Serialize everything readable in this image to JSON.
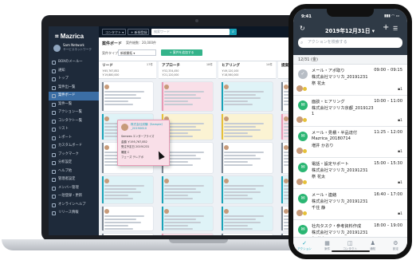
{
  "app": {
    "logo": "Mazrica",
    "user_name": "Sam Network",
    "user_company": "サービスネットワーク"
  },
  "sidebar": {
    "items": [
      {
        "label": "BOXのメール一",
        "active": false
      },
      {
        "label": "通知",
        "active": false
      },
      {
        "label": "トップ",
        "active": false
      },
      {
        "label": "案件出一覧",
        "active": false
      },
      {
        "label": "案件ボード",
        "active": true
      },
      {
        "label": "案件一覧",
        "active": false
      },
      {
        "label": "アクション一覧",
        "active": false
      },
      {
        "label": "コンタクト一覧",
        "active": false
      },
      {
        "label": "リスト",
        "active": false
      },
      {
        "label": "レポート",
        "active": false
      },
      {
        "label": "カスタムボード",
        "active": false
      },
      {
        "label": "ブックマーク",
        "active": false
      },
      {
        "label": "分析設定",
        "active": false
      },
      {
        "label": "ヘルプ他",
        "active": false
      },
      {
        "label": "管理者設定",
        "active": false
      },
      {
        "label": "メンバー管理",
        "active": false
      },
      {
        "label": "一括登録・更新",
        "active": false
      },
      {
        "label": "オンラインヘルプ",
        "active": false
      },
      {
        "label": "リリース情報",
        "active": false
      }
    ]
  },
  "topbar": {
    "contact_select": "コンタクト",
    "entry_label": "新規登録",
    "search_placeholder": "検索ワード"
  },
  "board": {
    "title": "案件ボード",
    "subtitle": "案件総数：20,000件",
    "right_text": "表示させた案件",
    "filter_label": "案件タイプ",
    "filter_value": "新規開拓",
    "filter_button": "+ 案件を追加する"
  },
  "columns": [
    {
      "name": "リード",
      "count": "17件",
      "stat1": "￥65,767,852",
      "stat2": "￥19,880,000"
    },
    {
      "name": "アプローチ",
      "count": "18件",
      "stat1": "￥52,334,450",
      "stat2": "￥21,120,000"
    },
    {
      "name": "ヒアリング",
      "count": "14件",
      "stat1": "￥49,120,100",
      "stat2": "￥18,560,000"
    },
    {
      "name": "提案",
      "count": "9件",
      "stat1": "",
      "stat2": ""
    }
  ],
  "popup": {
    "title": "株式会社試験（Sample）_20190610",
    "rows": [
      "Semees エンタープライズ",
      "金額 ￥195,767,852",
      "受注予定日 20191231",
      "確度 C",
      "フェーズ テレアポ"
    ]
  },
  "phone": {
    "time": "9:41",
    "status": "▮▮▮ ◠ ▭",
    "date_title": "2019年12月31日",
    "search_placeholder": "アクションを検索する",
    "day_label": "12/31 (金)",
    "activities": [
      {
        "title": "メール・アポ取り",
        "time": "09:00 – 09:15",
        "line1": "株式会社マツリカ_20191231",
        "line2": "祭 花太",
        "badge": "1",
        "done": true
      },
      {
        "title": "面談・ヒアリング",
        "time": "10:00 – 11:00",
        "line1": "株式会社マツリカ京都_2019123",
        "line2": "1",
        "badge": "1",
        "done": false
      },
      {
        "title": "メール・見積・半品達付",
        "time": "11:25 – 12:00",
        "line1": "Mazrica_20180714",
        "line2": "増井 かおり",
        "badge": "1",
        "done": false
      },
      {
        "title": "電話・設定サポート",
        "time": "15:00 – 15:30",
        "line1": "株式会社マツリカ_20191231",
        "line2": "祭 花太",
        "badge": "1",
        "done": false
      },
      {
        "title": "メール・連絡",
        "time": "16:40 – 17:00",
        "line1": "株式会社マツリカ_20191231",
        "line2": "千住 静",
        "badge": "1",
        "done": false
      },
      {
        "title": "社内タスク・参考資料作成",
        "time": "18:00 – 19:00",
        "line1": "株式会社マツリカ_20191231",
        "line2": "祭 花太",
        "badge": "1",
        "done": false
      }
    ],
    "tabs": [
      {
        "label": "アクション",
        "icon": "✓",
        "active": true
      },
      {
        "label": "案件",
        "icon": "▦",
        "active": false
      },
      {
        "label": "コンタクト",
        "icon": "◫",
        "active": false
      },
      {
        "label": "通知",
        "icon": "♟",
        "active": false
      },
      {
        "label": "設定",
        "icon": "⚙",
        "active": false
      }
    ]
  },
  "colors": {
    "sidebar": "#1e2a3a",
    "accent": "#1aa3b8",
    "green": "#2bb673",
    "active_nav": "#3b6ea5"
  }
}
